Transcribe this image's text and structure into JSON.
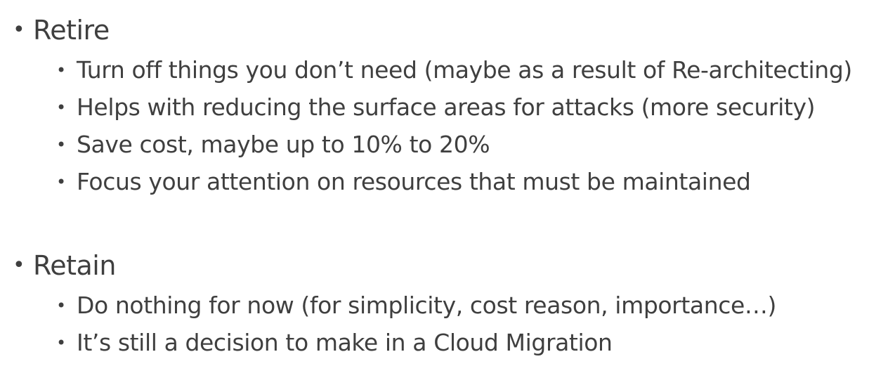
{
  "sections": [
    {
      "heading": "Retire",
      "items": [
        "Turn off things you don’t need (maybe as a result of Re-architecting)",
        "Helps with reducing the surface areas for attacks (more security)",
        "Save cost, maybe up to 10% to 20%",
        "Focus your attention on resources that must be maintained"
      ]
    },
    {
      "heading": "Retain",
      "items": [
        "Do nothing for now (for simplicity, cost reason, importance…)",
        "It’s still a decision to make in a Cloud Migration"
      ]
    }
  ],
  "bullet_glyph": "•",
  "colors": {
    "text": "#3f3f3f",
    "background": "#ffffff"
  }
}
